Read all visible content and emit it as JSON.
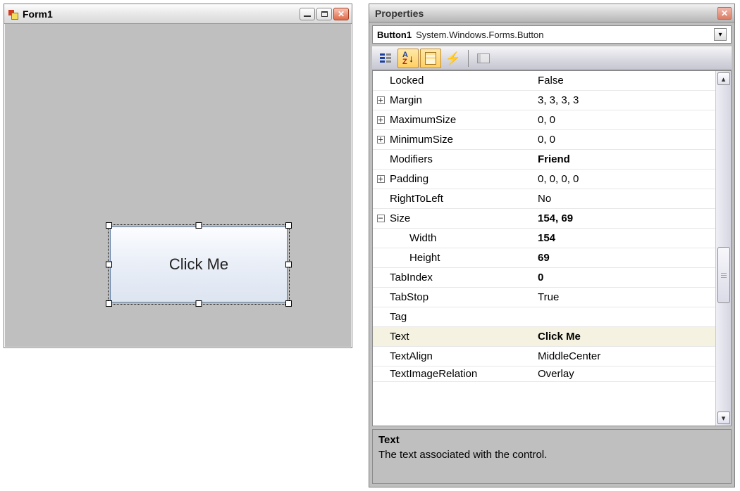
{
  "form": {
    "title": "Form1",
    "button_text": "Click Me"
  },
  "properties": {
    "panel_title": "Properties",
    "object_name": "Button1",
    "object_type": "System.Windows.Forms.Button",
    "rows": [
      {
        "expander": "",
        "indent": false,
        "name": "Locked",
        "value": "False",
        "bold": false,
        "selected": false
      },
      {
        "expander": "+",
        "indent": false,
        "name": "Margin",
        "value": "3, 3, 3, 3",
        "bold": false,
        "selected": false
      },
      {
        "expander": "+",
        "indent": false,
        "name": "MaximumSize",
        "value": "0, 0",
        "bold": false,
        "selected": false
      },
      {
        "expander": "+",
        "indent": false,
        "name": "MinimumSize",
        "value": "0, 0",
        "bold": false,
        "selected": false
      },
      {
        "expander": "",
        "indent": false,
        "name": "Modifiers",
        "value": "Friend",
        "bold": true,
        "selected": false
      },
      {
        "expander": "+",
        "indent": false,
        "name": "Padding",
        "value": "0, 0, 0, 0",
        "bold": false,
        "selected": false
      },
      {
        "expander": "",
        "indent": false,
        "name": "RightToLeft",
        "value": "No",
        "bold": false,
        "selected": false
      },
      {
        "expander": "-",
        "indent": false,
        "name": "Size",
        "value": "154, 69",
        "bold": true,
        "selected": false
      },
      {
        "expander": "",
        "indent": true,
        "name": "Width",
        "value": "154",
        "bold": true,
        "selected": false
      },
      {
        "expander": "",
        "indent": true,
        "name": "Height",
        "value": "69",
        "bold": true,
        "selected": false
      },
      {
        "expander": "",
        "indent": false,
        "name": "TabIndex",
        "value": "0",
        "bold": true,
        "selected": false
      },
      {
        "expander": "",
        "indent": false,
        "name": "TabStop",
        "value": "True",
        "bold": false,
        "selected": false
      },
      {
        "expander": "",
        "indent": false,
        "name": "Tag",
        "value": "",
        "bold": false,
        "selected": false
      },
      {
        "expander": "",
        "indent": false,
        "name": "Text",
        "value": "Click Me",
        "bold": true,
        "selected": true
      },
      {
        "expander": "",
        "indent": false,
        "name": "TextAlign",
        "value": "MiddleCenter",
        "bold": false,
        "selected": false
      },
      {
        "expander": "",
        "indent": false,
        "name": "TextImageRelation",
        "value": "Overlay",
        "bold": false,
        "selected": false
      }
    ],
    "description": {
      "title": "Text",
      "body": "The text associated with the control."
    }
  }
}
